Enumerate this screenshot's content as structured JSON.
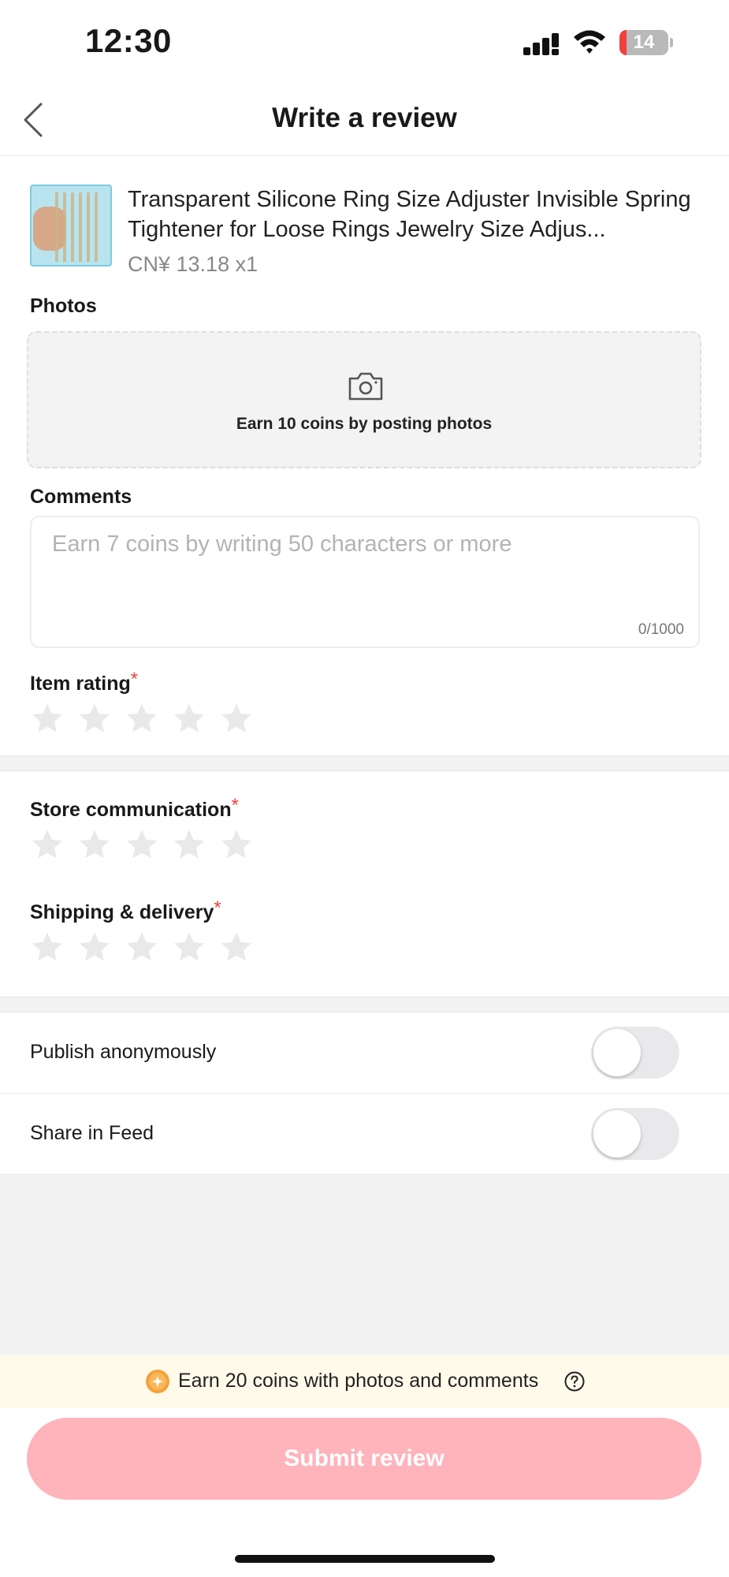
{
  "status_bar": {
    "time": "12:30",
    "battery_level": "14",
    "battery_fraction": 0.14
  },
  "nav": {
    "title": "Write a review",
    "back_icon": "chevron-left-icon"
  },
  "product": {
    "title": "Transparent Silicone Ring Size Adjuster Invisible Spring Tightener for Loose Rings Jewelry Size Adjus...",
    "price": "CN¥ 13.18 x1"
  },
  "photos": {
    "label": "Photos",
    "icon": "camera-icon",
    "hint": "Earn 10 coins by posting photos"
  },
  "comments": {
    "label": "Comments",
    "placeholder": "Earn 7 coins by writing 50 characters or more",
    "value": "",
    "count": "0/1000"
  },
  "ratings": {
    "required_mark": "*",
    "item_rating": {
      "label": "Item rating",
      "value": 0,
      "max": 5
    },
    "store_communication": {
      "label": "Store communication",
      "value": 0,
      "max": 5
    },
    "shipping_delivery": {
      "label": "Shipping & delivery",
      "value": 0,
      "max": 5
    }
  },
  "toggles": {
    "publish_anonymously": {
      "label": "Publish anonymously",
      "on": false
    },
    "share_in_feed": {
      "label": "Share in Feed",
      "on": false
    }
  },
  "promo": {
    "text": "Earn 20 coins with photos and comments",
    "icon": "coin-icon",
    "help_icon": "question-circle-icon"
  },
  "submit": {
    "label": "Submit review"
  },
  "colors": {
    "accent_disabled": "#ffb3ba",
    "required": "#e8453c",
    "star_empty": "#e9e9e9",
    "promo_bg": "#fffaea",
    "coin": "#f5a13a"
  }
}
